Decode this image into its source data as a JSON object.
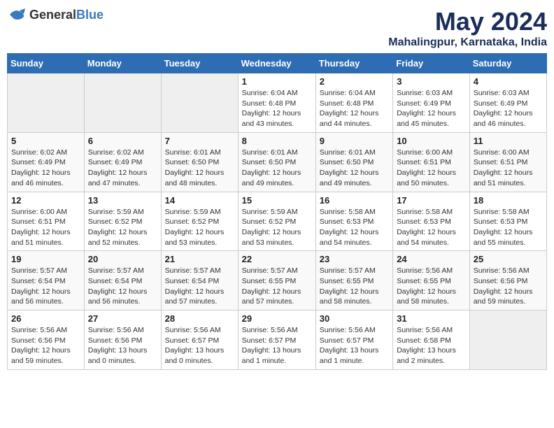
{
  "header": {
    "logo_general": "General",
    "logo_blue": "Blue",
    "title": "May 2024",
    "subtitle": "Mahalingpur, Karnataka, India"
  },
  "calendar": {
    "days_of_week": [
      "Sunday",
      "Monday",
      "Tuesday",
      "Wednesday",
      "Thursday",
      "Friday",
      "Saturday"
    ],
    "weeks": [
      [
        {
          "day": "",
          "info": ""
        },
        {
          "day": "",
          "info": ""
        },
        {
          "day": "",
          "info": ""
        },
        {
          "day": "1",
          "info": "Sunrise: 6:04 AM\nSunset: 6:48 PM\nDaylight: 12 hours\nand 43 minutes."
        },
        {
          "day": "2",
          "info": "Sunrise: 6:04 AM\nSunset: 6:48 PM\nDaylight: 12 hours\nand 44 minutes."
        },
        {
          "day": "3",
          "info": "Sunrise: 6:03 AM\nSunset: 6:49 PM\nDaylight: 12 hours\nand 45 minutes."
        },
        {
          "day": "4",
          "info": "Sunrise: 6:03 AM\nSunset: 6:49 PM\nDaylight: 12 hours\nand 46 minutes."
        }
      ],
      [
        {
          "day": "5",
          "info": "Sunrise: 6:02 AM\nSunset: 6:49 PM\nDaylight: 12 hours\nand 46 minutes."
        },
        {
          "day": "6",
          "info": "Sunrise: 6:02 AM\nSunset: 6:49 PM\nDaylight: 12 hours\nand 47 minutes."
        },
        {
          "day": "7",
          "info": "Sunrise: 6:01 AM\nSunset: 6:50 PM\nDaylight: 12 hours\nand 48 minutes."
        },
        {
          "day": "8",
          "info": "Sunrise: 6:01 AM\nSunset: 6:50 PM\nDaylight: 12 hours\nand 49 minutes."
        },
        {
          "day": "9",
          "info": "Sunrise: 6:01 AM\nSunset: 6:50 PM\nDaylight: 12 hours\nand 49 minutes."
        },
        {
          "day": "10",
          "info": "Sunrise: 6:00 AM\nSunset: 6:51 PM\nDaylight: 12 hours\nand 50 minutes."
        },
        {
          "day": "11",
          "info": "Sunrise: 6:00 AM\nSunset: 6:51 PM\nDaylight: 12 hours\nand 51 minutes."
        }
      ],
      [
        {
          "day": "12",
          "info": "Sunrise: 6:00 AM\nSunset: 6:51 PM\nDaylight: 12 hours\nand 51 minutes."
        },
        {
          "day": "13",
          "info": "Sunrise: 5:59 AM\nSunset: 6:52 PM\nDaylight: 12 hours\nand 52 minutes."
        },
        {
          "day": "14",
          "info": "Sunrise: 5:59 AM\nSunset: 6:52 PM\nDaylight: 12 hours\nand 53 minutes."
        },
        {
          "day": "15",
          "info": "Sunrise: 5:59 AM\nSunset: 6:52 PM\nDaylight: 12 hours\nand 53 minutes."
        },
        {
          "day": "16",
          "info": "Sunrise: 5:58 AM\nSunset: 6:53 PM\nDaylight: 12 hours\nand 54 minutes."
        },
        {
          "day": "17",
          "info": "Sunrise: 5:58 AM\nSunset: 6:53 PM\nDaylight: 12 hours\nand 54 minutes."
        },
        {
          "day": "18",
          "info": "Sunrise: 5:58 AM\nSunset: 6:53 PM\nDaylight: 12 hours\nand 55 minutes."
        }
      ],
      [
        {
          "day": "19",
          "info": "Sunrise: 5:57 AM\nSunset: 6:54 PM\nDaylight: 12 hours\nand 56 minutes."
        },
        {
          "day": "20",
          "info": "Sunrise: 5:57 AM\nSunset: 6:54 PM\nDaylight: 12 hours\nand 56 minutes."
        },
        {
          "day": "21",
          "info": "Sunrise: 5:57 AM\nSunset: 6:54 PM\nDaylight: 12 hours\nand 57 minutes."
        },
        {
          "day": "22",
          "info": "Sunrise: 5:57 AM\nSunset: 6:55 PM\nDaylight: 12 hours\nand 57 minutes."
        },
        {
          "day": "23",
          "info": "Sunrise: 5:57 AM\nSunset: 6:55 PM\nDaylight: 12 hours\nand 58 minutes."
        },
        {
          "day": "24",
          "info": "Sunrise: 5:56 AM\nSunset: 6:55 PM\nDaylight: 12 hours\nand 58 minutes."
        },
        {
          "day": "25",
          "info": "Sunrise: 5:56 AM\nSunset: 6:56 PM\nDaylight: 12 hours\nand 59 minutes."
        }
      ],
      [
        {
          "day": "26",
          "info": "Sunrise: 5:56 AM\nSunset: 6:56 PM\nDaylight: 12 hours\nand 59 minutes."
        },
        {
          "day": "27",
          "info": "Sunrise: 5:56 AM\nSunset: 6:56 PM\nDaylight: 13 hours\nand 0 minutes."
        },
        {
          "day": "28",
          "info": "Sunrise: 5:56 AM\nSunset: 6:57 PM\nDaylight: 13 hours\nand 0 minutes."
        },
        {
          "day": "29",
          "info": "Sunrise: 5:56 AM\nSunset: 6:57 PM\nDaylight: 13 hours\nand 1 minute."
        },
        {
          "day": "30",
          "info": "Sunrise: 5:56 AM\nSunset: 6:57 PM\nDaylight: 13 hours\nand 1 minute."
        },
        {
          "day": "31",
          "info": "Sunrise: 5:56 AM\nSunset: 6:58 PM\nDaylight: 13 hours\nand 2 minutes."
        },
        {
          "day": "",
          "info": ""
        }
      ]
    ]
  }
}
